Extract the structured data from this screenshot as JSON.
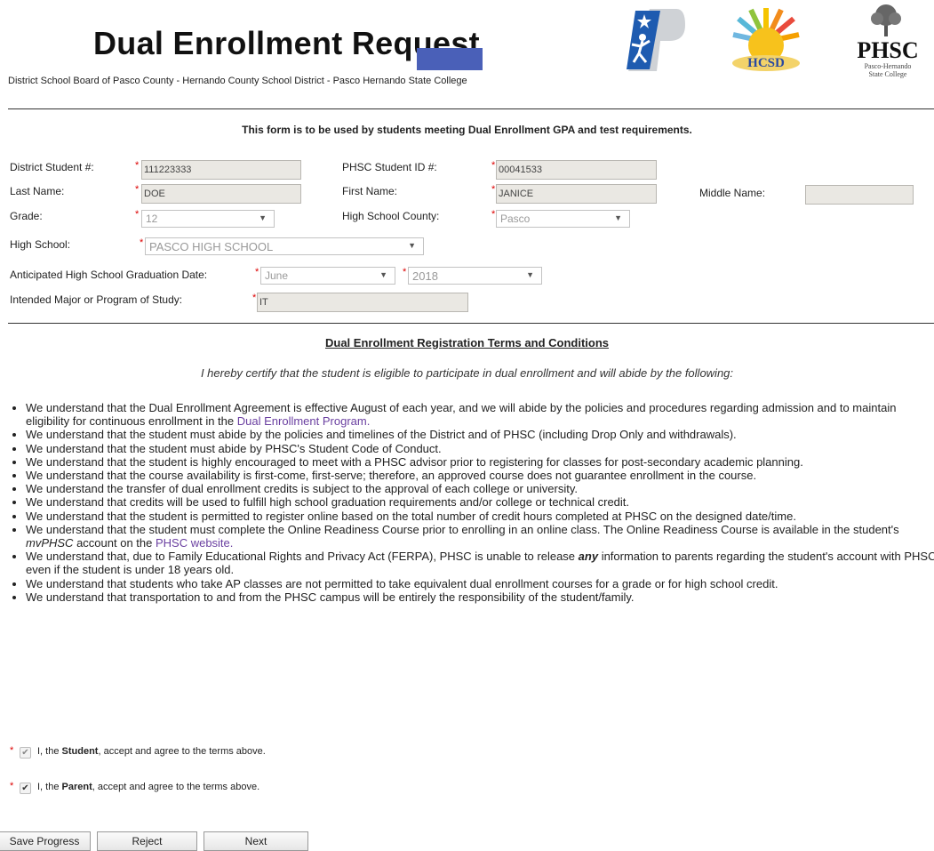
{
  "header": {
    "title": "Dual Enrollment Request",
    "subtitle": "District School Board of Pasco County - Hernando County School District - Pasco Hernando State College",
    "logos": {
      "phsc_text": "PHSC",
      "phsc_sub1": "Pasco-Hernando",
      "phsc_sub2": "State College",
      "hcsd_text": "HCSD"
    }
  },
  "notice": "This form is to be used by students meeting Dual Enrollment GPA and test requirements.",
  "form": {
    "district_student_label": "District Student #:",
    "district_student_value": "111223333",
    "phsc_id_label": "PHSC Student ID #:",
    "phsc_id_value": "00041533",
    "last_name_label": "Last Name:",
    "last_name_value": "DOE",
    "first_name_label": "First Name:",
    "first_name_value": "JANICE",
    "middle_name_label": "Middle Name:",
    "middle_name_value": "",
    "grade_label": "Grade:",
    "grade_value": "12",
    "county_label": "High School County:",
    "county_value": "Pasco",
    "high_school_label": "High School:",
    "high_school_value": "PASCO HIGH SCHOOL",
    "grad_date_label": "Anticipated High School Graduation Date:",
    "grad_month_value": "June",
    "grad_year_value": "2018",
    "major_label": "Intended Major or Program of Study:",
    "major_value": "IT",
    "required_mark": "*",
    "dropdown_arrow": "▼"
  },
  "terms": {
    "heading": "Dual Enrollment Registration Terms and Conditions",
    "intro": "I hereby certify that the student is eligible to participate in dual enrollment and will abide by the following:",
    "items": [
      "We understand that the Dual Enrollment Agreement is effective August of each year, and we will abide by the policies and procedures regarding admission and to maintain eligibility for continuous enrollment in the",
      "We understand that the student must abide by the policies and timelines of the District and of PHSC (including Drop Only and withdrawals).",
      "We understand that the student must abide by PHSC's Student Code of Conduct.",
      "We understand that the student is highly encouraged to meet with a PHSC advisor prior to registering for classes for post-secondary academic planning.",
      "We understand that the course availability is first-come, first-serve; therefore, an approved course does not guarantee enrollment in the course.",
      "We understand the transfer of dual enrollment credits is subject to the approval of each college or university.",
      "We understand that credits will be used to fulfill high school graduation requirements and/or college or technical credit.",
      "We understand that the student is permitted to register online based on the total number of credit hours completed at PHSC on the designed date/time.",
      "We understand that the student must complete the Online Readiness Course prior to enrolling in an online class. The Online Readiness Course is available in the student's",
      "We understand that, due to Family Educational Rights and Privacy Act (FERPA), PHSC is unable to release",
      "We understand that students who take AP classes are not permitted to take equivalent dual enrollment courses for a grade or for high school credit.",
      "We understand that transportation to and from the PHSC campus will be entirely the responsibility of the student/family."
    ],
    "item1_link": "Dual Enrollment Program.",
    "item9_mid": "mvPHSC",
    "item9_mid2": " account on the ",
    "item9_link": "PHSC website.",
    "item10_em": "any",
    "item10_rest": " information to parents regarding the student's account with PHSC even if the student is under 18 years old."
  },
  "agree": {
    "student_pre": "I, the ",
    "student_bold": "Student",
    "student_post": ", accept and agree to the terms above.",
    "parent_pre": "I, the ",
    "parent_bold": "Parent",
    "parent_post": ", accept and agree to the terms above.",
    "check": "✔"
  },
  "buttons": {
    "save": "Save Progress",
    "reject": "Reject",
    "next": "Next"
  },
  "colors": {
    "required": "#dd0000",
    "link": "#6a3fa0",
    "field_bg": "#eae8e3"
  }
}
